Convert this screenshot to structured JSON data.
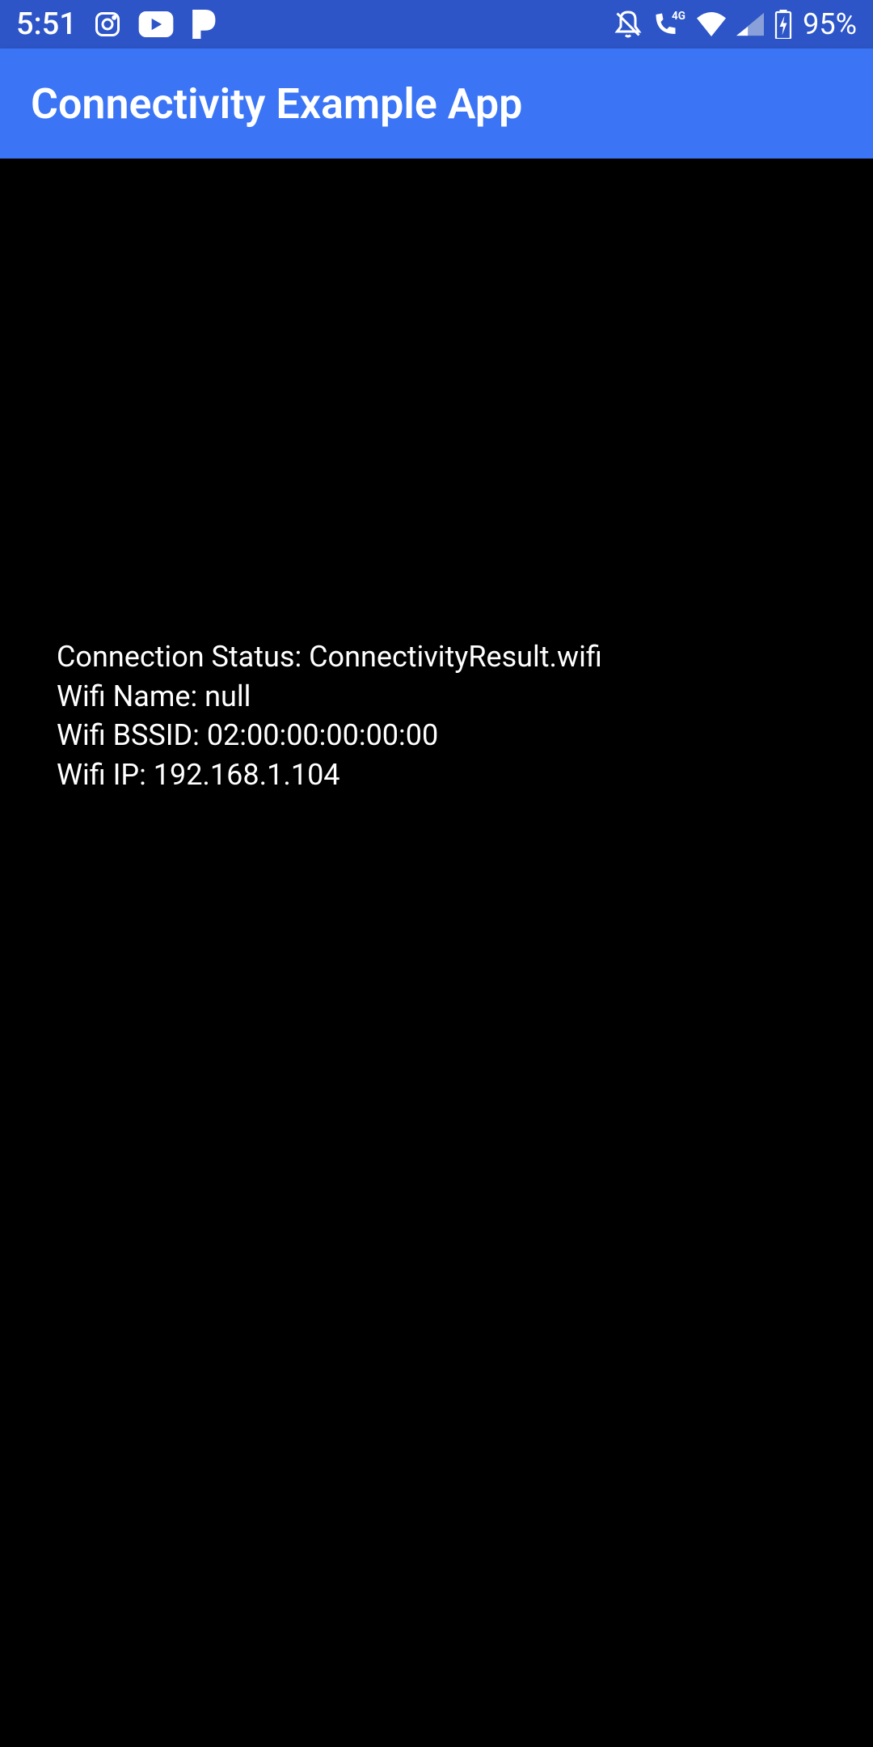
{
  "status_bar": {
    "time": "5:51",
    "battery": "95%",
    "icons": {
      "instagram": "instagram-icon",
      "youtube": "youtube-icon",
      "pandora": "pandora-icon",
      "dnd": "do-not-disturb-icon",
      "call_4g": "4g-call-icon",
      "wifi": "wifi-icon",
      "signal": "signal-icon",
      "battery_charging": "battery-charging-icon"
    }
  },
  "app_bar": {
    "title": "Connectivity Example App"
  },
  "main": {
    "connection_status_label": "Connection Status: ",
    "connection_status_value": "ConnectivityResult.wifi",
    "wifi_name_label": "Wifi Name: ",
    "wifi_name_value": "null",
    "wifi_bssid_label": "Wifi BSSID: ",
    "wifi_bssid_value": "02:00:00:00:00:00",
    "wifi_ip_label": "Wifi IP: ",
    "wifi_ip_value": "192.168.1.104"
  },
  "colors": {
    "status_bar": "#2d55c7",
    "app_bar": "#3b75f5",
    "background": "#000000",
    "text": "#ffffff"
  }
}
